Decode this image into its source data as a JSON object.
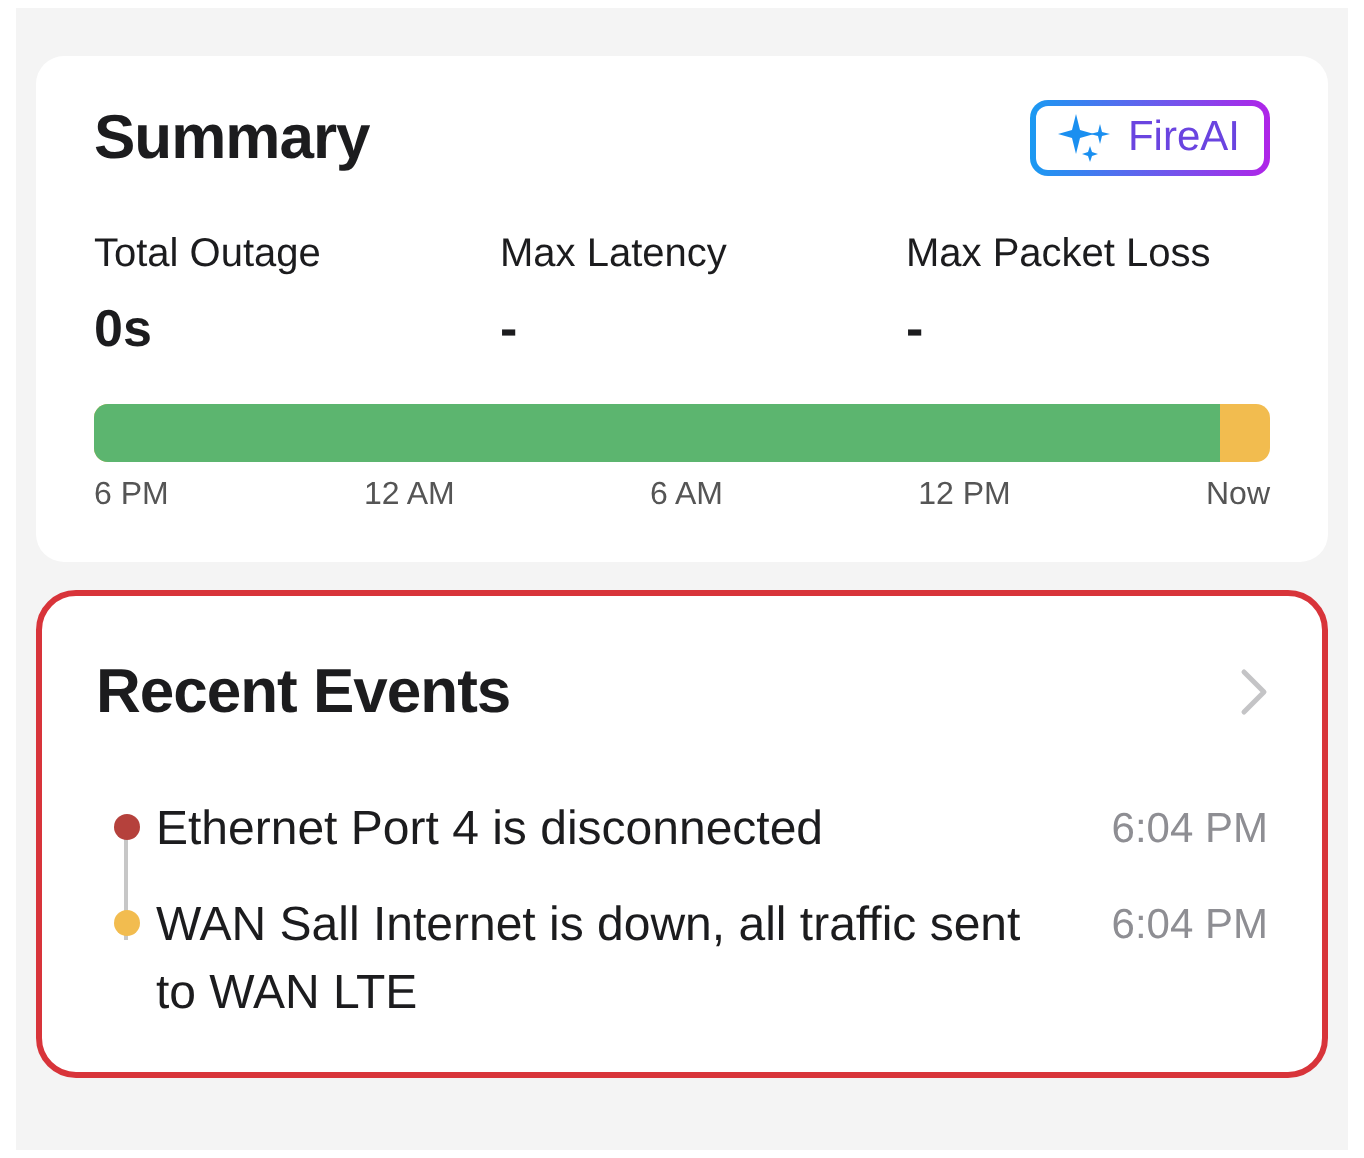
{
  "summary": {
    "title": "Summary",
    "fireai_button": "FireAI",
    "metrics": [
      {
        "label": "Total Outage",
        "value": "0s"
      },
      {
        "label": "Max Latency",
        "value": "-"
      },
      {
        "label": "Max Packet Loss",
        "value": "-"
      }
    ],
    "timeline": {
      "level": 0.957,
      "labels": [
        "6 PM",
        "12 AM",
        "6 AM",
        "12 PM",
        "Now"
      ]
    }
  },
  "recent_events": {
    "title": "Recent Events",
    "highlighted": true,
    "events": [
      {
        "text": "Ethernet Port 4 is disconnected",
        "time": "6:04 PM",
        "color": "#b5413c"
      },
      {
        "text": "WAN Sall Internet is down, all traffic sent to WAN LTE",
        "time": "6:04 PM",
        "color": "#f2bc4f"
      }
    ]
  }
}
